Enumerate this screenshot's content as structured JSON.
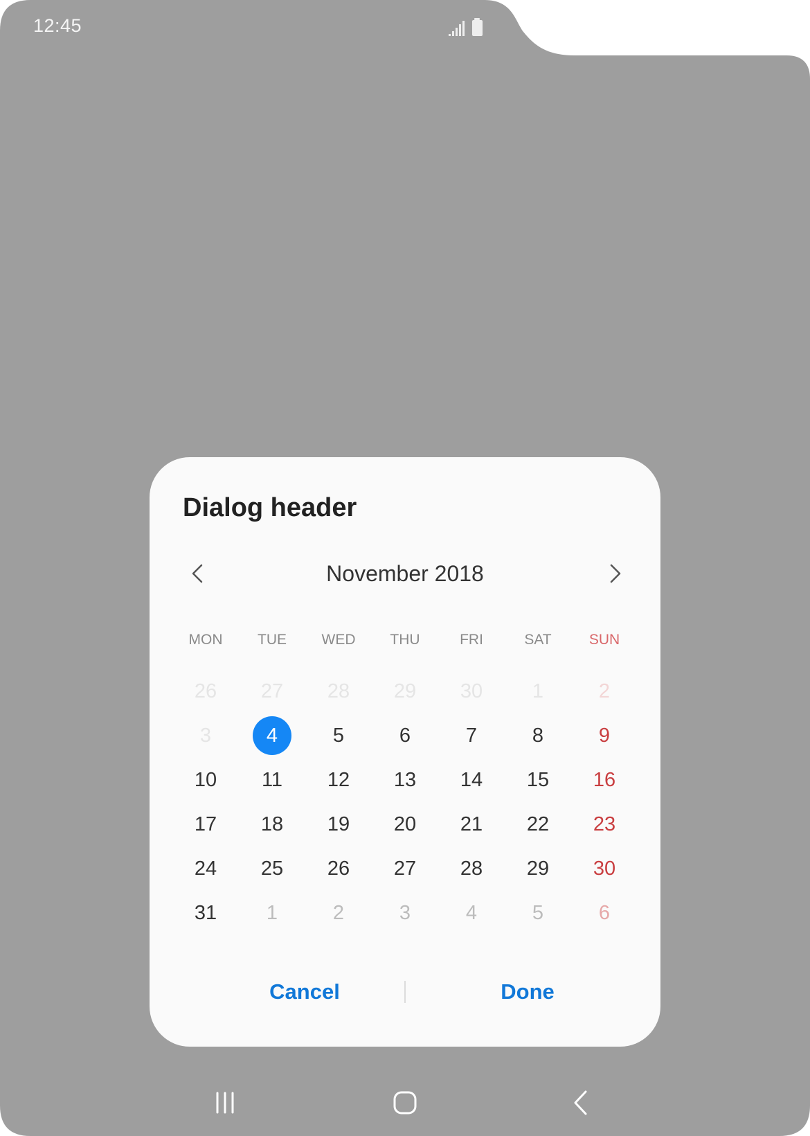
{
  "status_bar": {
    "time": "12:45",
    "icons": [
      "signal-icon",
      "battery-icon"
    ]
  },
  "colors": {
    "scrim": "#9e9e9e",
    "dialog_bg": "#fafafa",
    "accent": "#1587f5",
    "button_text": "#1178d8",
    "sunday": "#c93e40"
  },
  "dialog": {
    "title": "Dialog header",
    "month_label": "November 2018",
    "prev_icon": "chevron-left-icon",
    "next_icon": "chevron-right-icon",
    "weekdays": [
      "MON",
      "TUE",
      "WED",
      "THU",
      "FRI",
      "SAT",
      "SUN"
    ],
    "selected_day": "4",
    "weeks": [
      [
        {
          "d": "26",
          "t": "prev"
        },
        {
          "d": "27",
          "t": "prev"
        },
        {
          "d": "28",
          "t": "prev"
        },
        {
          "d": "29",
          "t": "prev"
        },
        {
          "d": "30",
          "t": "prev"
        },
        {
          "d": "1",
          "t": "prev"
        },
        {
          "d": "2",
          "t": "prev"
        }
      ],
      [
        {
          "d": "3",
          "t": "prev"
        },
        {
          "d": "4",
          "t": "cur"
        },
        {
          "d": "5",
          "t": "cur"
        },
        {
          "d": "6",
          "t": "cur"
        },
        {
          "d": "7",
          "t": "cur"
        },
        {
          "d": "8",
          "t": "cur"
        },
        {
          "d": "9",
          "t": "cur"
        }
      ],
      [
        {
          "d": "10",
          "t": "cur"
        },
        {
          "d": "11",
          "t": "cur"
        },
        {
          "d": "12",
          "t": "cur"
        },
        {
          "d": "13",
          "t": "cur"
        },
        {
          "d": "14",
          "t": "cur"
        },
        {
          "d": "15",
          "t": "cur"
        },
        {
          "d": "16",
          "t": "cur"
        }
      ],
      [
        {
          "d": "17",
          "t": "cur"
        },
        {
          "d": "18",
          "t": "cur"
        },
        {
          "d": "19",
          "t": "cur"
        },
        {
          "d": "20",
          "t": "cur"
        },
        {
          "d": "21",
          "t": "cur"
        },
        {
          "d": "22",
          "t": "cur"
        },
        {
          "d": "23",
          "t": "cur"
        }
      ],
      [
        {
          "d": "24",
          "t": "cur"
        },
        {
          "d": "25",
          "t": "cur"
        },
        {
          "d": "26",
          "t": "cur"
        },
        {
          "d": "27",
          "t": "cur"
        },
        {
          "d": "28",
          "t": "cur"
        },
        {
          "d": "29",
          "t": "cur"
        },
        {
          "d": "30",
          "t": "cur"
        }
      ],
      [
        {
          "d": "31",
          "t": "cur"
        },
        {
          "d": "1",
          "t": "next"
        },
        {
          "d": "2",
          "t": "next"
        },
        {
          "d": "3",
          "t": "next"
        },
        {
          "d": "4",
          "t": "next"
        },
        {
          "d": "5",
          "t": "next"
        },
        {
          "d": "6",
          "t": "next"
        }
      ]
    ],
    "cancel_label": "Cancel",
    "done_label": "Done"
  },
  "navigation_bar": {
    "recents_icon": "recents-icon",
    "home_icon": "home-icon",
    "back_icon": "back-icon"
  }
}
